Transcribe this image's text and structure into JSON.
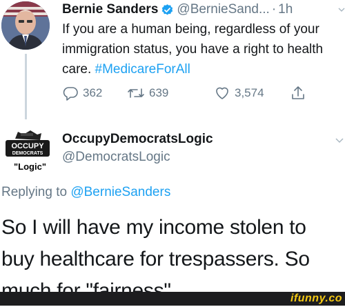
{
  "tweet": {
    "author_name": "Bernie Sanders",
    "author_handle": "@BernieSand...",
    "separator": "·",
    "time": "1h",
    "text_plain": "If you are a human being, regardless of your immigration status, you have a right to health care. ",
    "hashtag": "#MedicareForAll",
    "replies": "362",
    "retweets": "639",
    "likes": "3,574"
  },
  "reply": {
    "author_name": "OccupyDemocratsLogic",
    "author_handle": "@DemocratsLogic",
    "avatar_text_top": "OCCUPY",
    "avatar_text_bottom": "DEMOCRATS",
    "avatar_caption": "\"Logic\"",
    "replying_prefix": "Replying to ",
    "replying_to": "@BernieSanders",
    "text": "So I will have my income stolen to buy healthcare for trespassers. So much for \"fairness\"...."
  },
  "watermark": {
    "text": "ifunny.co"
  },
  "colors": {
    "link": "#1da1f2",
    "muted": "#657786",
    "watermark": "#f5c913"
  },
  "icons": [
    "verified-badge-icon",
    "chevron-down-icon",
    "reply-icon",
    "retweet-icon",
    "like-icon",
    "share-icon"
  ]
}
